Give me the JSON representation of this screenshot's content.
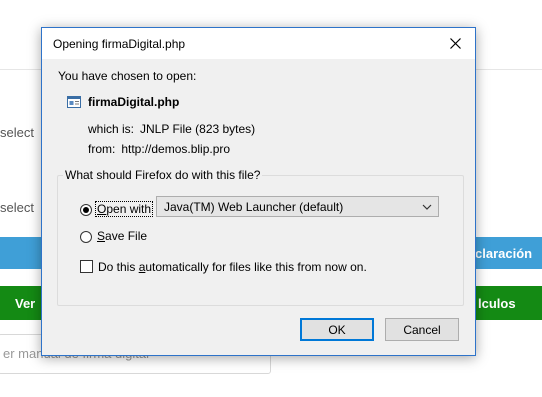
{
  "background": {
    "select_label_1": "select",
    "select_label_2": "select",
    "blue_button_fragment": "claración",
    "green_button_left": "Ver",
    "green_button_right": "lculos",
    "input_fragment": "er manual de firma digital"
  },
  "dialog": {
    "title": "Opening firmaDigital.php",
    "intro": "You have chosen to open:",
    "file_name": "firmaDigital.php",
    "which_is_label": "which is:",
    "which_is_value": "JNLP File (823 bytes)",
    "from_label": "from:",
    "from_value": "http://demos.blip.pro",
    "question": "What should Firefox do with this file?",
    "open_with": {
      "before": "",
      "mnemonic": "O",
      "after": "pen with"
    },
    "application": "Java(TM) Web Launcher (default)",
    "save_file": {
      "mnemonic": "S",
      "after": "ave File"
    },
    "auto": {
      "before": "Do this ",
      "mnemonic": "a",
      "after": "utomatically for files like this from now on."
    },
    "ok_label": "OK",
    "cancel_label": "Cancel",
    "open_with_selected": true,
    "auto_checked": false
  },
  "colors": {
    "dialog_border": "#2e73c9",
    "blue_bar": "#3f9fd7",
    "green_bar": "#148a14",
    "default_button_border": "#0078d7"
  },
  "icons": {
    "close": "close-icon",
    "file": "file-icon",
    "dropdown": "chevron-down-icon"
  }
}
